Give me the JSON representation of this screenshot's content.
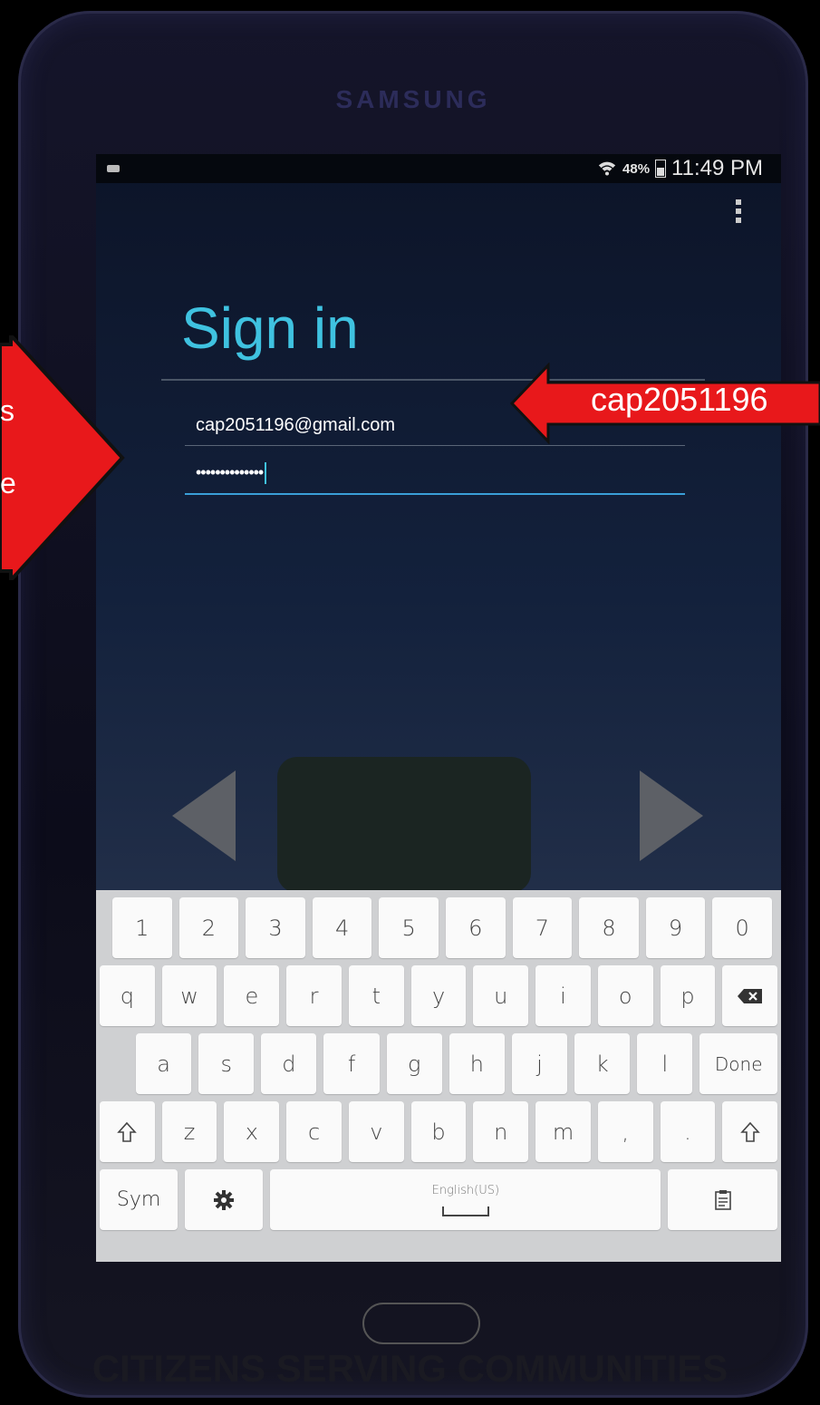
{
  "device": {
    "brand": "SAMSUNG"
  },
  "status_bar": {
    "battery": "48%",
    "time": "11:49 PM"
  },
  "signin": {
    "title": "Sign in",
    "email": "cap2051196@gmail.com",
    "password_mask": "••••••••••••••"
  },
  "keyboard": {
    "row_numbers": [
      "1",
      "2",
      "3",
      "4",
      "5",
      "6",
      "7",
      "8",
      "9",
      "0"
    ],
    "row_top": [
      "q",
      "w",
      "e",
      "r",
      "t",
      "y",
      "u",
      "i",
      "o",
      "p"
    ],
    "row_home": [
      "a",
      "s",
      "d",
      "f",
      "g",
      "h",
      "j",
      "k",
      "l"
    ],
    "done_label": "Done",
    "row_bottom": [
      "z",
      "x",
      "c",
      "v",
      "b",
      "n",
      "m",
      ",",
      "."
    ],
    "sym_label": "Sym",
    "language_label": "English(US)"
  },
  "annotations": {
    "right_callout": "cap2051196",
    "left_callout_line1": "s",
    "left_callout_line2": "e"
  },
  "footer": {
    "caption": "CITIZENS SERVING COMMUNITIES"
  },
  "colors": {
    "accent": "#3fc2e0",
    "focus_underline": "#3a9fd8",
    "callout_red": "#e8181b"
  }
}
